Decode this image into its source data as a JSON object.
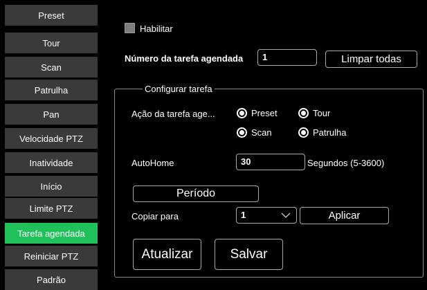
{
  "sidebar": {
    "items": [
      {
        "label": "Preset"
      },
      {
        "label": "Tour"
      },
      {
        "label": "Scan"
      },
      {
        "label": "Patrulha"
      },
      {
        "label": "Pan"
      },
      {
        "label": "Velocidade PTZ"
      },
      {
        "label": "Inatividade"
      },
      {
        "label": "Início"
      },
      {
        "label": "Limite PTZ"
      },
      {
        "label": "Tarefa agendada"
      },
      {
        "label": "Reiniciar PTZ"
      },
      {
        "label": "Padrão"
      }
    ],
    "active_label": "Tarefa agendada",
    "active_color": "#20c05a"
  },
  "main": {
    "enable_label": "Habilitar",
    "task_number_label": "Número da tarefa agendada",
    "task_number_value": "1",
    "clear_all_label": "Limpar todas",
    "group": {
      "legend": "Configurar tarefa",
      "action_label": "Ação da tarefa age...",
      "options": [
        "Preset",
        "Tour",
        "Scan",
        "Patrulha"
      ],
      "autohome_label": "AutoHome",
      "autohome_value": "30",
      "autohome_unit": "Segundos (5-3600)",
      "period_label": "Período",
      "copy_to_label": "Copiar para",
      "copy_to_value": "1",
      "apply_label": "Aplicar"
    },
    "refresh_label": "Atualizar",
    "save_label": "Salvar"
  }
}
